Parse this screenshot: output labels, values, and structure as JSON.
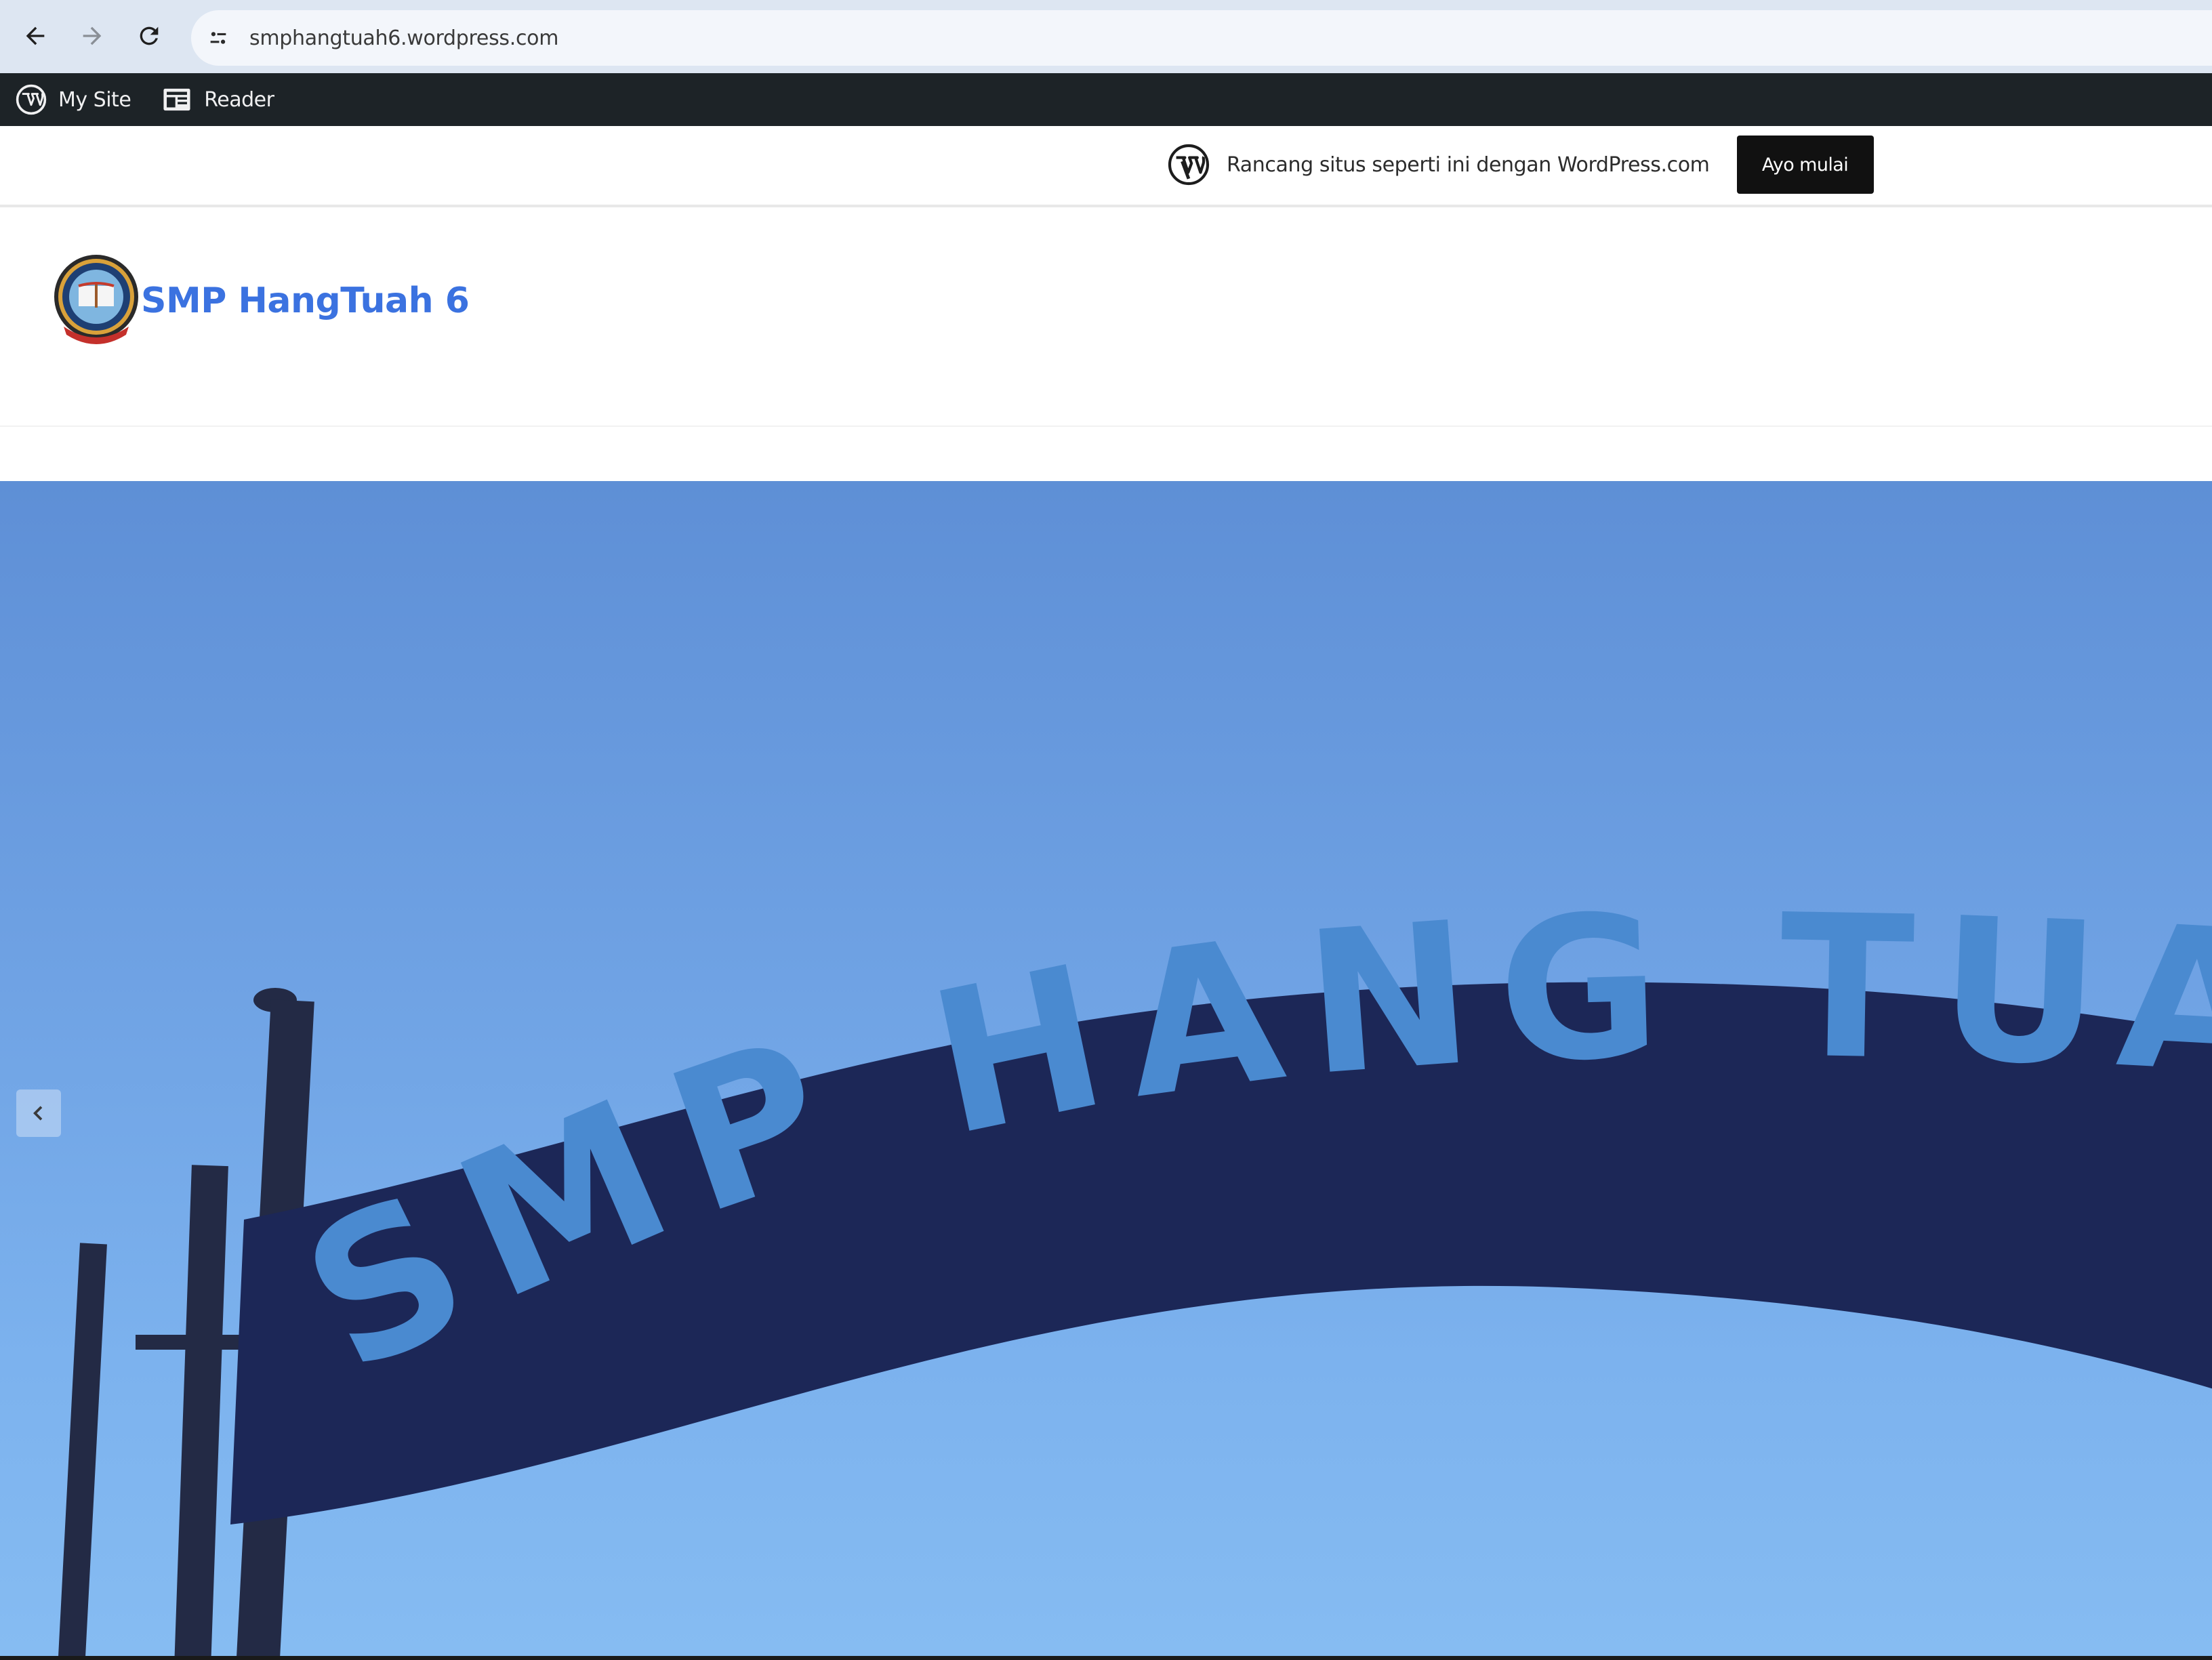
{
  "browser": {
    "url": "smphangtuah6.wordpress.com"
  },
  "admin_bar": {
    "my_site": "My Site",
    "reader": "Reader"
  },
  "promo_banner": {
    "text": "Rancang situs seperti ini dengan WordPress.com",
    "button": "Ayo mulai"
  },
  "site": {
    "title": "SMP HangTuah 6"
  },
  "hero": {
    "sign_text": "SMP HANG TUAH"
  },
  "colors": {
    "site_title": "#3b72e0",
    "admin_bar_bg": "#1d2327",
    "sky": "#6ea1e3",
    "sign": "#1c2757",
    "sign_letters": "#4a8ad0"
  },
  "icons": [
    "back-arrow-icon",
    "forward-arrow-icon",
    "reload-icon",
    "site-settings-icon",
    "wordpress-icon",
    "reader-icon",
    "chevron-left-icon"
  ]
}
